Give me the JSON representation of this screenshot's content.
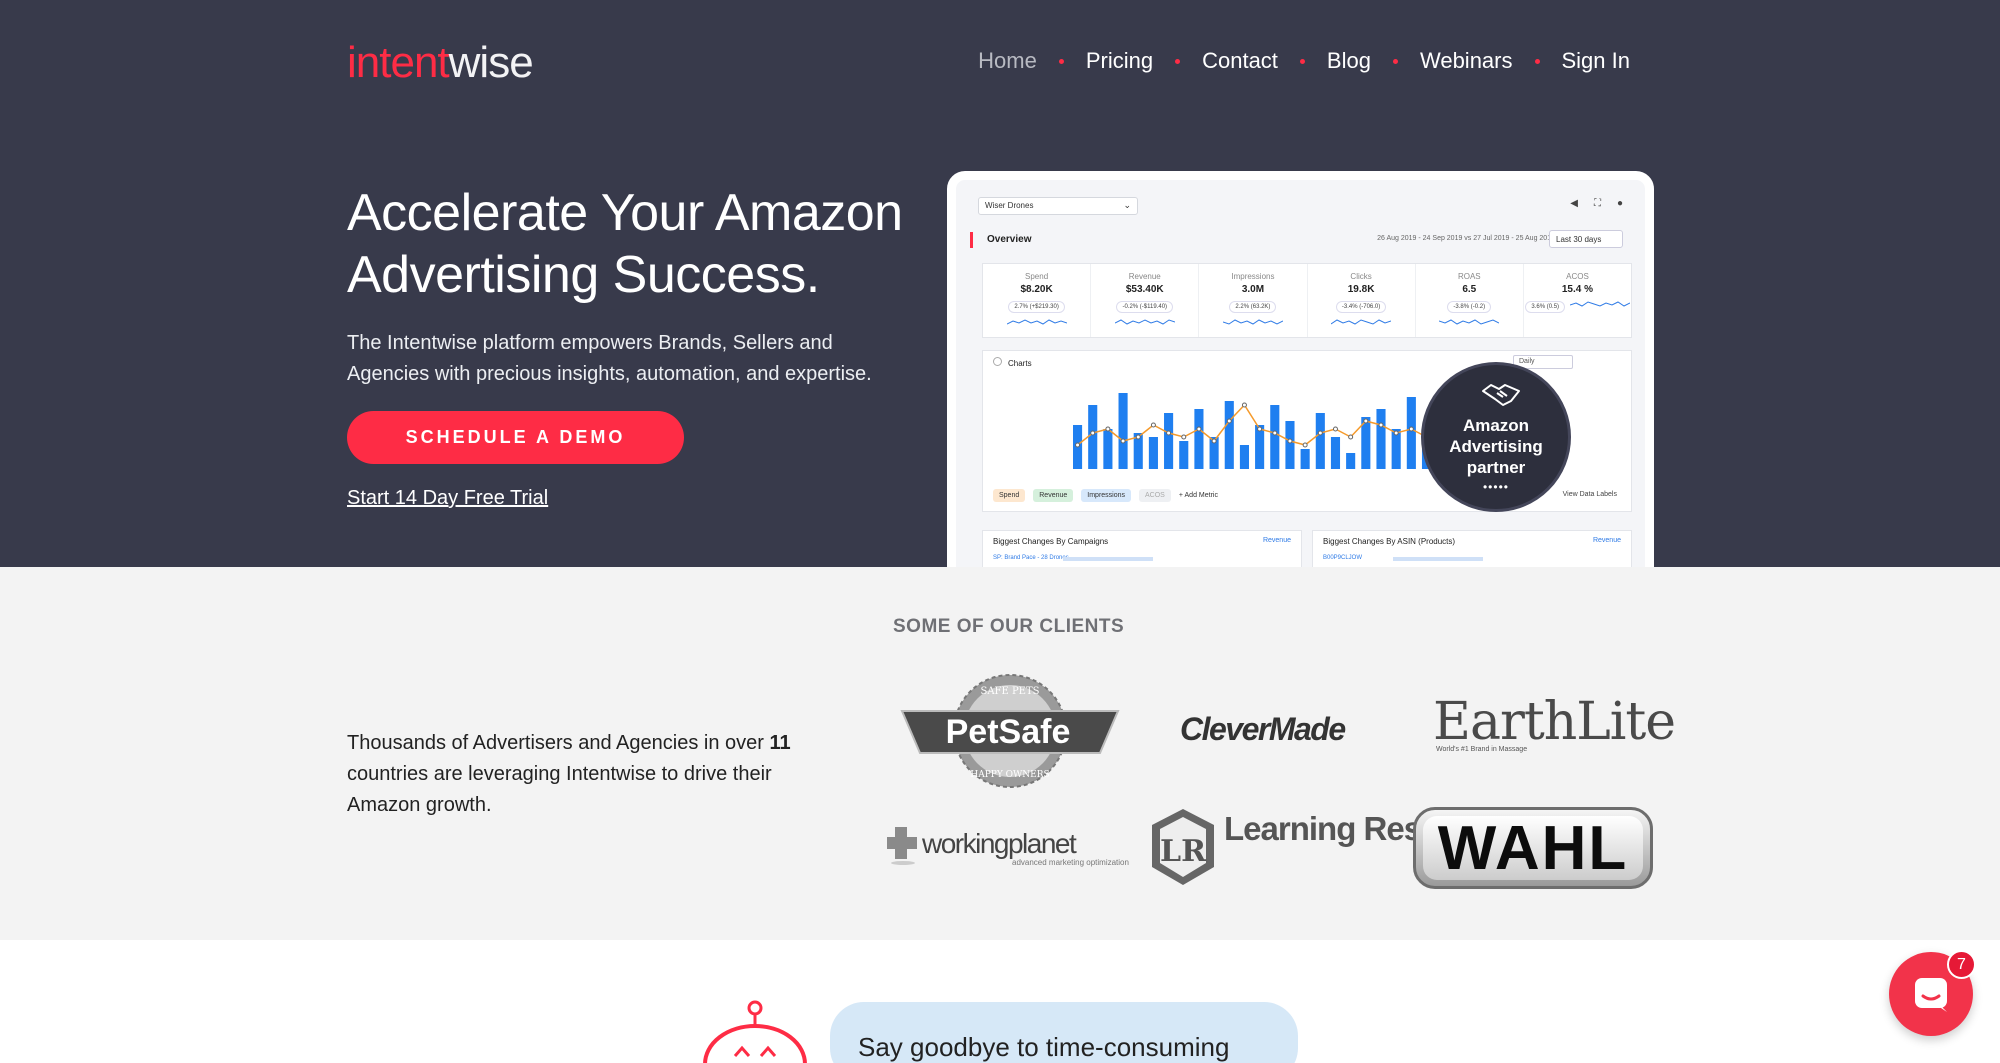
{
  "header": {
    "logo_part1": "intent",
    "logo_part2": "wise",
    "nav": [
      {
        "label": "Home",
        "active": true
      },
      {
        "label": "Pricing"
      },
      {
        "label": "Contact"
      },
      {
        "label": "Blog"
      },
      {
        "label": "Webinars"
      },
      {
        "label": "Sign In"
      }
    ]
  },
  "hero": {
    "title": "Accelerate Your Amazon Advertising Success.",
    "subtitle": "The Intentwise platform empowers Brands, Sellers and Agencies with precious insights, automation, and expertise.",
    "cta_label": "SCHEDULE A DEMO",
    "trial_label": "Start 14 Day Free Trial"
  },
  "dashboard": {
    "account": "Wiser Drones",
    "section": "Overview",
    "date_range": "26 Aug 2019 - 24 Sep 2019 vs 27 Jul 2019 - 25 Aug 2019",
    "period": "Last 30 days",
    "kpis": [
      {
        "label": "Spend",
        "value": "$8.20K",
        "delta": "2.7% (+$219.30)"
      },
      {
        "label": "Revenue",
        "value": "$53.40K",
        "delta": "-0.2% (-$119.40)"
      },
      {
        "label": "Impressions",
        "value": "3.0M",
        "delta": "2.2% (63.2K)"
      },
      {
        "label": "Clicks",
        "value": "19.8K",
        "delta": "-3.4% (-706.0)"
      },
      {
        "label": "ROAS",
        "value": "6.5",
        "delta": "-3.8% (-0.2)"
      },
      {
        "label": "ACOS",
        "value": "15.4 %",
        "delta": "3.6% (0.5)"
      }
    ],
    "charts_title": "Charts",
    "chart_granularity": "Daily",
    "legend": [
      "Spend",
      "Revenue",
      "Impressions",
      "ACOS"
    ],
    "add_metric": "+ Add Metric",
    "view_labels": "View Data Labels",
    "bottom_cards": [
      {
        "title": "Biggest Changes By Campaigns",
        "metric": "Revenue",
        "row": "SP: Brand Pace - 28 Drones"
      },
      {
        "title": "Biggest Changes By ASIN (Products)",
        "metric": "Revenue",
        "row": "B00P9CLJOW"
      }
    ],
    "partner_badge": "Amazon Advertising partner"
  },
  "clients": {
    "heading": "SOME OF OUR CLIENTS",
    "text_before": "Thousands of Advertisers and Agencies in over",
    "count": "11",
    "text_after": "countries are leveraging Intentwise to drive their Amazon growth.",
    "logos": {
      "petsafe": "PetSafe",
      "petsafe_ring_top": "SAFE PETS",
      "petsafe_ring_bottom": "HAPPY OWNERS",
      "clevermade": "CleverMade",
      "earthlite": "EarthLite",
      "earthlite_tag": "World's #1 Brand in Massage",
      "workingplanet": "workingplanet",
      "workingplanet_tag": "advanced marketing optimization",
      "learning_resources": "Learning Resources",
      "lr_mark": "LR",
      "wahl": "WAHL"
    }
  },
  "bottom": {
    "bubble_text": "Say goodbye to time-consuming",
    "chat_badge_count": "7"
  },
  "colors": {
    "brand_red": "#fe2c45",
    "hero_bg": "#383a4b",
    "chart_bar": "#1f7ff0",
    "chart_line": "#f59a2b"
  }
}
